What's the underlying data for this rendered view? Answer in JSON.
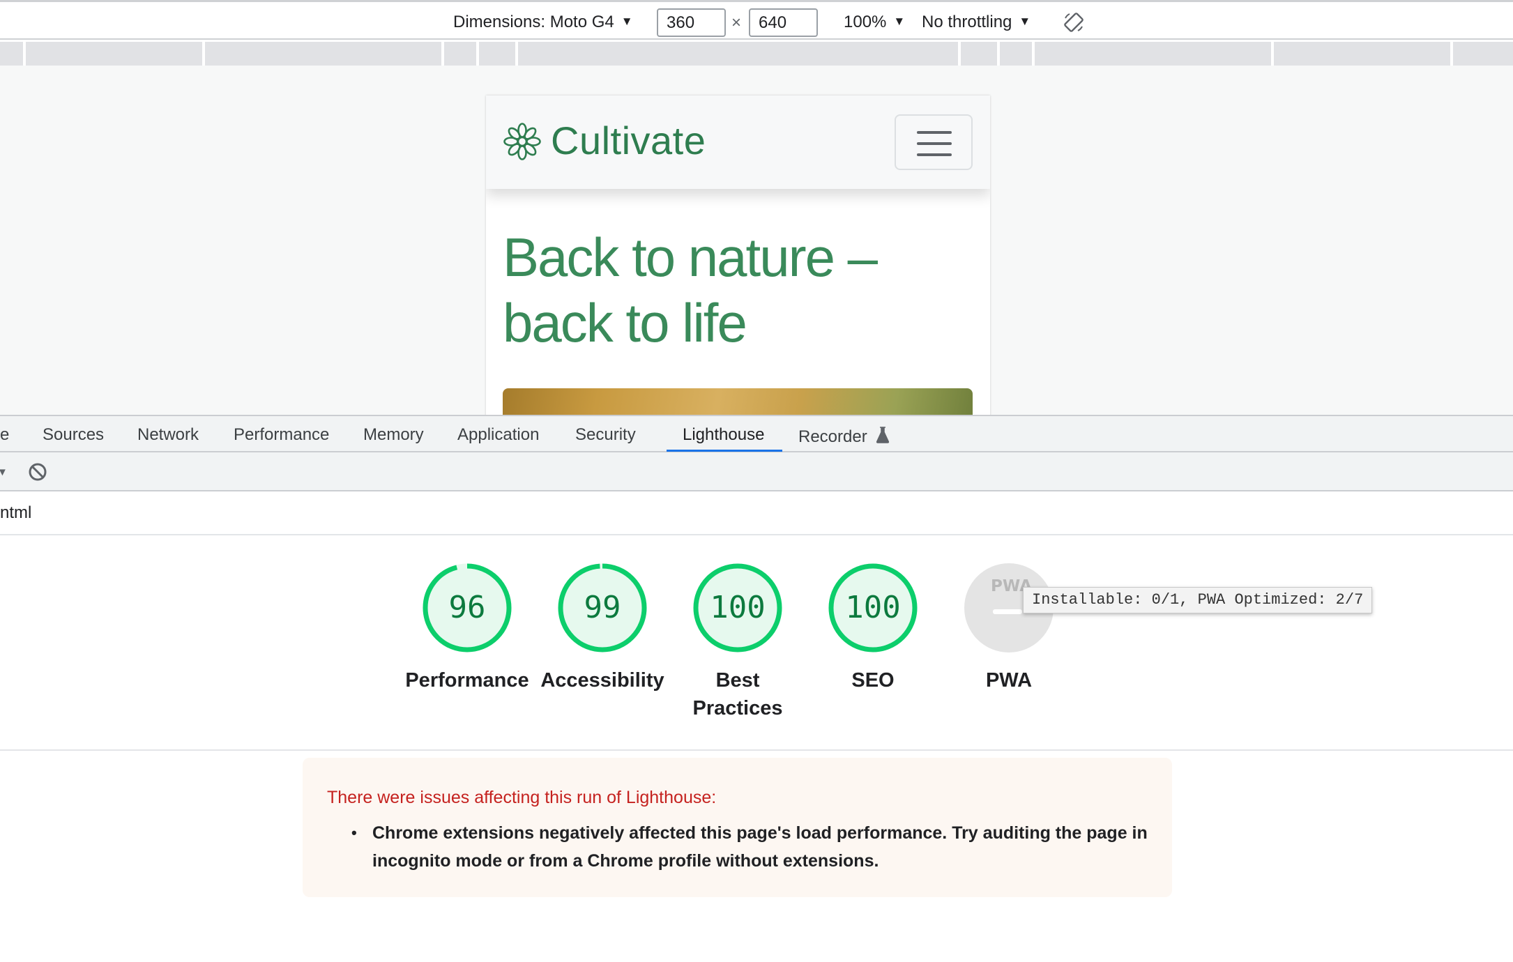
{
  "device_toolbar": {
    "dimensions_label": "Dimensions: Moto G4",
    "width_value": "360",
    "times_symbol": "×",
    "height_value": "640",
    "zoom_label": "100%",
    "throttling_label": "No throttling",
    "caret": "▼"
  },
  "site": {
    "brand_name": "Cultivate",
    "hero_line1": "Back to nature –",
    "hero_line2": "back to life",
    "brand_color": "#2e7d4f"
  },
  "devtools": {
    "tabs": [
      {
        "label": "e"
      },
      {
        "label": "Sources"
      },
      {
        "label": "Network"
      },
      {
        "label": "Performance"
      },
      {
        "label": "Memory"
      },
      {
        "label": "Application"
      },
      {
        "label": "Security"
      },
      {
        "label": "Lighthouse"
      },
      {
        "label": "Recorder"
      }
    ],
    "active_tab": "Lighthouse",
    "url_text": "ntml"
  },
  "lighthouse": {
    "scores": [
      {
        "label": "Performance",
        "score": "96",
        "fraction": 0.96
      },
      {
        "label": "Accessibility",
        "score": "99",
        "fraction": 0.99
      },
      {
        "label_line1": "Best",
        "label_line2": "Practices",
        "score": "100",
        "fraction": 1.0
      },
      {
        "label": "SEO",
        "score": "100",
        "fraction": 1.0
      },
      {
        "label": "PWA",
        "badge_text": "PWA"
      }
    ],
    "pass_color": "#0cce6b",
    "pwa_tooltip": "Installable: 0/1, PWA Optimized: 2/7",
    "warnings": {
      "heading": "There were issues affecting this run of Lighthouse:",
      "bullet": "•",
      "items": [
        {
          "line1": "Chrome extensions negatively affected this page's load performance. Try auditing the page in",
          "line2": "incognito mode or from a Chrome profile without extensions."
        }
      ]
    }
  }
}
